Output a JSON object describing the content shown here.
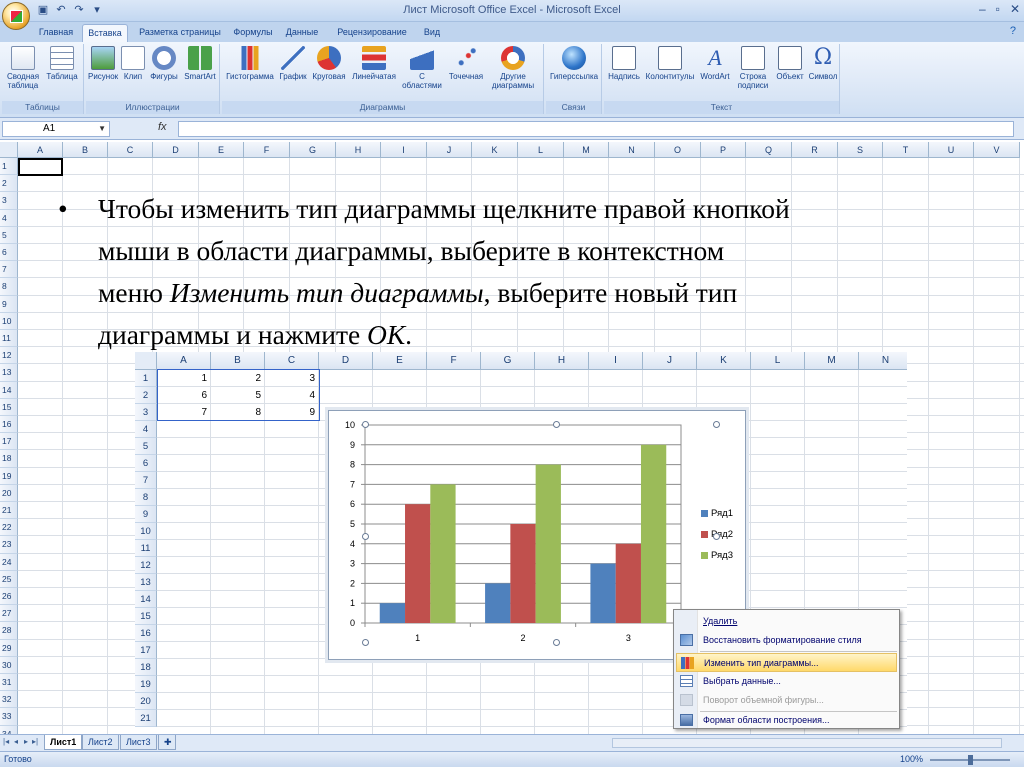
{
  "window": {
    "title": "Лист Microsoft Office Excel - Microsoft Excel"
  },
  "ribbon": {
    "tabs": [
      "Главная",
      "Вставка",
      "Разметка страницы",
      "Формулы",
      "Данные",
      "Рецензирование",
      "Вид"
    ],
    "active_tab": "Вставка",
    "groups": {
      "tables": {
        "label": "Таблицы",
        "buttons": [
          "Сводная таблица",
          "Таблица"
        ]
      },
      "illustrations": {
        "label": "Иллюстрации",
        "buttons": [
          "Рисунок",
          "Клип",
          "Фигуры",
          "SmartArt"
        ]
      },
      "charts": {
        "label": "Диаграммы",
        "buttons": [
          "Гистограмма",
          "График",
          "Круговая",
          "Линейчатая",
          "С областями",
          "Точечная",
          "Другие диаграммы"
        ]
      },
      "links": {
        "label": "Связи",
        "buttons": [
          "Гиперссылка"
        ]
      },
      "text": {
        "label": "Текст",
        "buttons": [
          "Надпись",
          "Колонтитулы",
          "WordArt",
          "Строка подписи",
          "Объект",
          "Символ"
        ]
      }
    }
  },
  "formula_bar": {
    "name_box": "A1",
    "fx": "fx",
    "formula": ""
  },
  "grid": {
    "columns": [
      "A",
      "B",
      "C",
      "D",
      "E",
      "F",
      "G",
      "H",
      "I",
      "J",
      "K",
      "L",
      "M",
      "N",
      "O",
      "P",
      "Q",
      "R",
      "S",
      "T",
      "U",
      "V"
    ],
    "rows": [
      "1",
      "2",
      "3",
      "4",
      "5",
      "6",
      "7",
      "8",
      "9",
      "10",
      "11",
      "12",
      "13",
      "14",
      "15",
      "16",
      "17",
      "18",
      "19",
      "20",
      "21",
      "22",
      "23",
      "24",
      "25",
      "26",
      "27",
      "28",
      "29",
      "30",
      "31",
      "32",
      "33",
      "34"
    ]
  },
  "slide_text": {
    "bullet": "•",
    "line1": "Чтобы изменить тип диаграммы щелкните правой кнопкой",
    "line2": "мыши в области диаграммы, выберите в контекстном",
    "line3_a": "меню ",
    "line3_italic": "Изменить тип диаграммы",
    "line3_b": ", выберите новый тип",
    "line4_a": "диаграммы и нажмите ",
    "line4_italic": "ОК",
    "line4_b": "."
  },
  "inset_sheet": {
    "columns": [
      "A",
      "B",
      "C",
      "D",
      "E",
      "F",
      "G",
      "H",
      "I",
      "J",
      "K",
      "L",
      "M",
      "N"
    ],
    "rows": [
      "1",
      "2",
      "3",
      "4",
      "5",
      "6",
      "7",
      "8",
      "9",
      "10",
      "11",
      "12",
      "13",
      "14",
      "15",
      "16",
      "17",
      "18",
      "19",
      "20",
      "21"
    ],
    "cells": [
      [
        "1",
        "2",
        "3"
      ],
      [
        "6",
        "5",
        "4"
      ],
      [
        "7",
        "8",
        "9"
      ]
    ]
  },
  "chart_data": {
    "type": "bar",
    "categories": [
      "1",
      "2",
      "3"
    ],
    "series": [
      {
        "name": "Ряд1",
        "values": [
          1,
          2,
          3
        ],
        "color": "#4f81bd"
      },
      {
        "name": "Ряд2",
        "values": [
          6,
          5,
          4
        ],
        "color": "#c0504d"
      },
      {
        "name": "Ряд3",
        "values": [
          7,
          8,
          9
        ],
        "color": "#9bbb59"
      }
    ],
    "ylim": [
      0,
      10
    ],
    "yticks": [
      "0",
      "1",
      "2",
      "3",
      "4",
      "5",
      "6",
      "7",
      "8",
      "9",
      "10"
    ],
    "grid": true,
    "legend": "right"
  },
  "context_menu": {
    "items": [
      {
        "label": "Удалить",
        "enabled": true
      },
      {
        "label": "Восстановить форматирование стиля",
        "enabled": true
      },
      {
        "label": "Изменить тип диаграммы...",
        "enabled": true,
        "highlighted": true
      },
      {
        "label": "Выбрать данные...",
        "enabled": true
      },
      {
        "label": "Поворот объемной фигуры...",
        "enabled": false
      },
      {
        "label": "Формат области построения...",
        "enabled": true
      }
    ]
  },
  "sheets": {
    "tabs": [
      "Лист1",
      "Лист2",
      "Лист3"
    ],
    "active": "Лист1"
  },
  "status": {
    "text": "Готово",
    "zoom": "100%"
  }
}
